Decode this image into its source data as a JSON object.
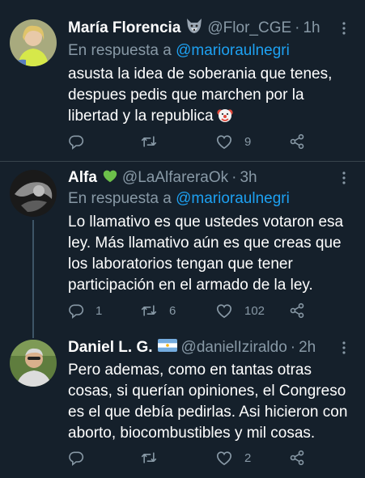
{
  "tweets": [
    {
      "name": "María Florencia",
      "handle": "@Flor_CGE",
      "time": "1h",
      "reply_prefix": "En respuesta a",
      "reply_to": "@marioraulnegri",
      "lines": [
        "asusta la idea de soberania que tenes,",
        "despues pedis que marchen por la",
        "libertad y la republica"
      ],
      "badge_icon": "wolf-emoji-icon",
      "trailing_emoji": "clown-face-emoji-icon",
      "replies": "",
      "retweets": "",
      "likes": "9"
    },
    {
      "name": "Alfa",
      "handle": "@LaAlfareraOk",
      "time": "3h",
      "reply_prefix": "En respuesta a",
      "reply_to": "@marioraulnegri",
      "lines": [
        "Lo llamativo es que ustedes votaron esa",
        "ley. Más llamativo aún es que creas que",
        "los laboratorios tengan que tener",
        "participación en el armado de la ley."
      ],
      "badge_icon": "green-heart-emoji-icon",
      "replies": "1",
      "retweets": "6",
      "likes": "102"
    },
    {
      "name": "Daniel L. G.",
      "handle": "@danielIziraldo",
      "time": "2h",
      "lines": [
        "Pero ademas, como en tantas otras",
        "cosas, si querían opiniones, el Congreso",
        "es el que debía pedirlas. Asi hicieron con",
        "aborto, biocombustibles y mil cosas."
      ],
      "badge_icon": "argentina-flag-icon",
      "replies": "",
      "retweets": "",
      "likes": "2"
    }
  ],
  "colors": {
    "background": "#15202b",
    "text": "#ffffff",
    "muted": "#8899a6",
    "link": "#1da1f2",
    "divider": "#38444d"
  }
}
